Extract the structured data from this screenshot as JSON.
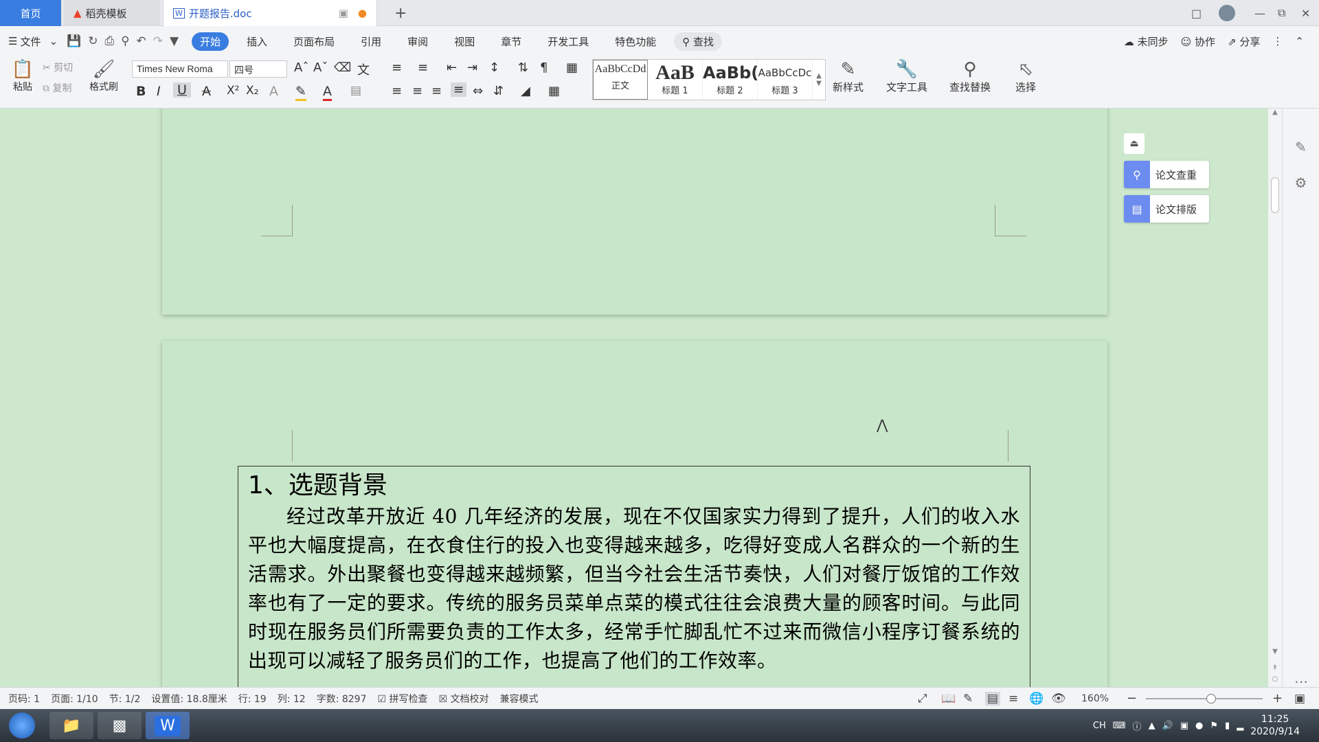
{
  "tabs": {
    "home": "首页",
    "templates": "稻壳模板",
    "doc": "开题报告.doc",
    "add": "+"
  },
  "menu": {
    "file": "文件",
    "items": [
      "开始",
      "插入",
      "页面布局",
      "引用",
      "审阅",
      "视图",
      "章节",
      "开发工具",
      "特色功能"
    ],
    "search": "查找",
    "right": [
      "未同步",
      "协作",
      "分享"
    ]
  },
  "ribbon": {
    "paste": "粘贴",
    "cut": "剪切",
    "copy": "复制",
    "format_painter": "格式刷",
    "font_name": "Times New Roma",
    "font_size": "四号",
    "styles": [
      {
        "preview": "AaBbCcDd",
        "name": "正文"
      },
      {
        "preview": "AaB",
        "name": "标题 1"
      },
      {
        "preview": "AaBb(",
        "name": "标题 2"
      },
      {
        "preview": "AaBbCcDc",
        "name": "标题 3"
      }
    ],
    "new_style": "新样式",
    "text_tools": "文字工具",
    "find_replace": "查找替换",
    "select": "选择"
  },
  "side_buttons": {
    "check": "论文查重",
    "layout": "论文排版"
  },
  "document": {
    "heading": "1、选题背景",
    "paragraph": "经过改革开放近 40 几年经济的发展，现在不仅国家实力得到了提升，人们的收入水平也大幅度提高，在衣食住行的投入也变得越来越多，吃得好变成人名群众的一个新的生活需求。外出聚餐也变得越来越频繁，但当今社会生活节奏快，人们对餐厅饭馆的工作效率也有了一定的要求。传统的服务员菜单点菜的模式往往会浪费大量的顾客时间。与此同时现在服务员们所需要负责的工作太多，经常手忙脚乱忙不过来而微信小程序订餐系统的出现可以减轻了服务员们的工作，也提高了他们的工作效率。"
  },
  "status": {
    "page_code": "页码: 1",
    "page": "页面: 1/10",
    "section": "节: 1/2",
    "setting": "设置值: 18.8厘米",
    "row": "行: 19",
    "col": "列: 12",
    "words": "字数: 8297",
    "spell": "拼写检查",
    "proof": "文档校对",
    "compat": "兼容模式",
    "zoom": "160%"
  },
  "taskbar": {
    "lang": "CH",
    "time": "11:25",
    "date": "2020/9/14"
  },
  "colors": {
    "accent": "#3a7de0",
    "page_bg": "#c8e6c9"
  }
}
